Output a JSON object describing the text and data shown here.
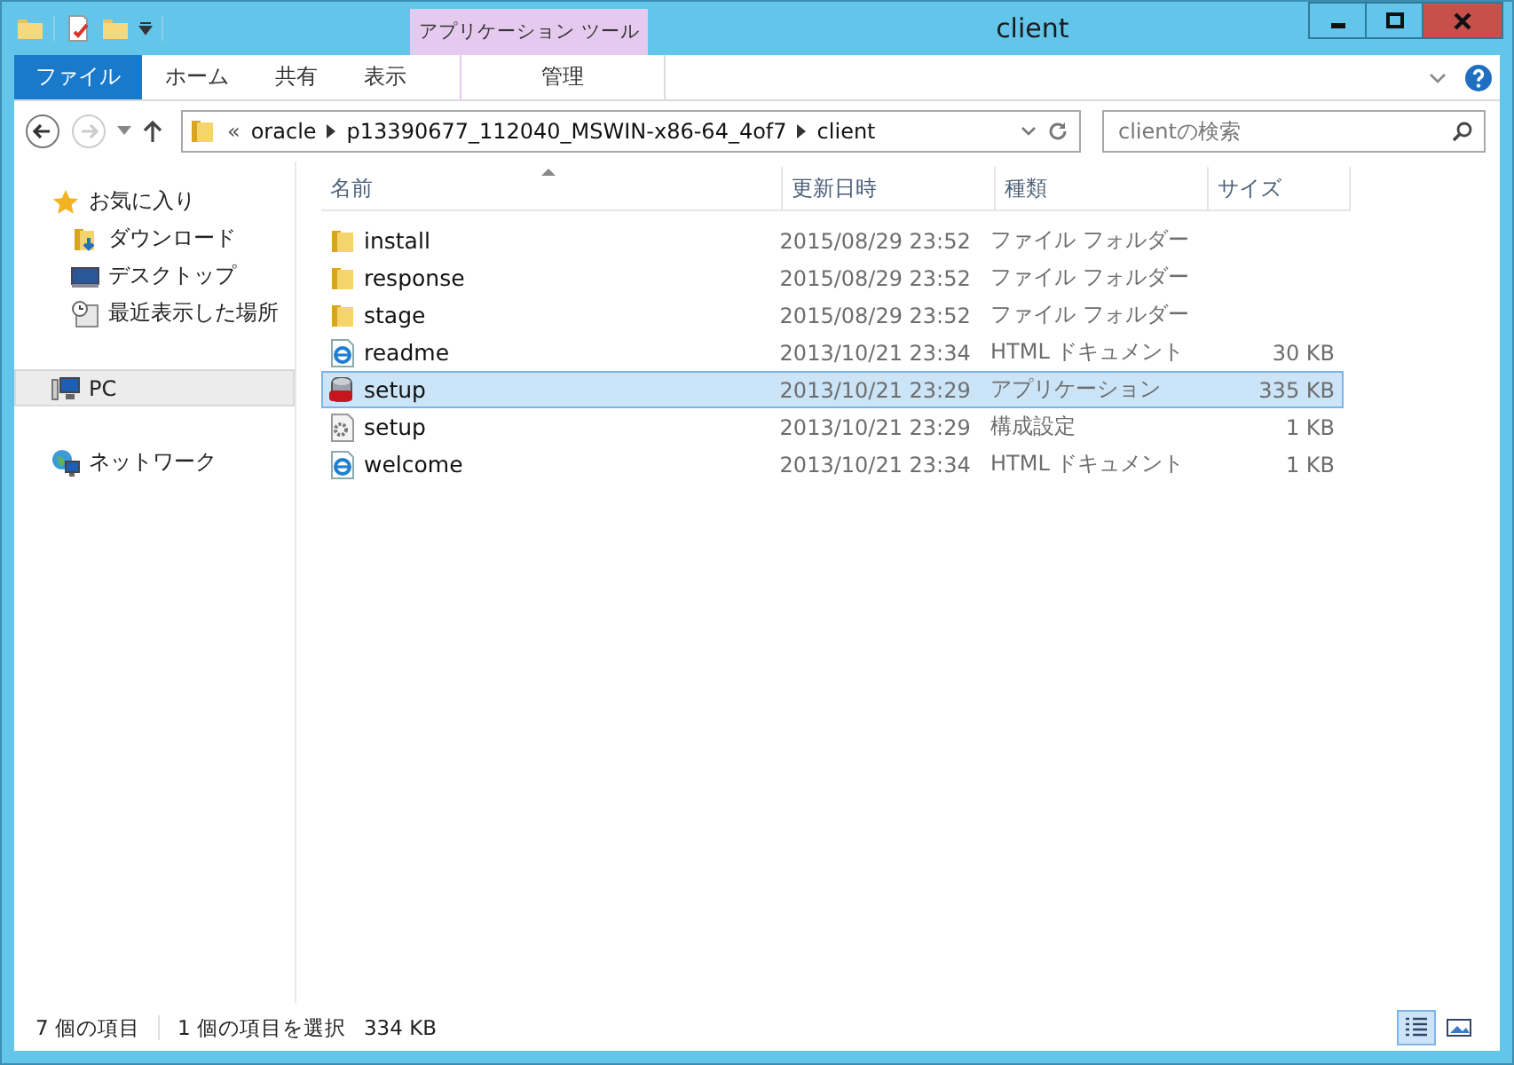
{
  "window": {
    "title": "client",
    "context_tab": "アプリケーション ツール"
  },
  "ribbon_tabs": [
    {
      "label": "ファイル",
      "kind": "file"
    },
    {
      "label": "ホーム",
      "kind": "normal"
    },
    {
      "label": "共有",
      "kind": "normal"
    },
    {
      "label": "表示",
      "kind": "normal"
    },
    {
      "label": "管理",
      "kind": "context"
    }
  ],
  "address": {
    "overflow": "«",
    "segments": [
      "oracle",
      "p13390677_112040_MSWIN-x86-64_4of7",
      "client"
    ]
  },
  "search": {
    "placeholder": "clientの検索"
  },
  "sidebar": {
    "items": [
      {
        "label": "お気に入り",
        "kind": "star",
        "selected": false,
        "children": [
          {
            "label": "ダウンロード",
            "kind": "download",
            "selected": false
          },
          {
            "label": "デスクトップ",
            "kind": "desktop",
            "selected": false
          },
          {
            "label": "最近表示した場所",
            "kind": "recent",
            "selected": false
          }
        ]
      },
      {
        "label": "PC",
        "kind": "pc",
        "selected": true
      },
      {
        "label": "ネットワーク",
        "kind": "network",
        "selected": false
      }
    ]
  },
  "table": {
    "columns": [
      {
        "label": "名前",
        "sorted": true
      },
      {
        "label": "更新日時",
        "sorted": false
      },
      {
        "label": "種類",
        "sorted": false
      },
      {
        "label": "サイズ",
        "sorted": false
      }
    ],
    "rows": [
      {
        "name": "install",
        "date": "2015/08/29 23:52",
        "type": "ファイル フォルダー",
        "kind": "folder",
        "selected": false
      },
      {
        "name": "response",
        "date": "2015/08/29 23:52",
        "type": "ファイル フォルダー",
        "kind": "folder",
        "selected": false
      },
      {
        "name": "stage",
        "date": "2015/08/29 23:52",
        "type": "ファイル フォルダー",
        "kind": "folder",
        "selected": false
      },
      {
        "name": "readme",
        "date": "2013/10/21 23:34",
        "type": "HTML ドキュメント",
        "size": "30 KB",
        "kind": "html",
        "selected": false
      },
      {
        "name": "setup",
        "date": "2013/10/21 23:29",
        "type": "アプリケーション",
        "size": "335 KB",
        "kind": "app",
        "selected": true
      },
      {
        "name": "setup",
        "date": "2013/10/21 23:29",
        "type": "構成設定",
        "size": "1 KB",
        "kind": "config",
        "selected": false
      },
      {
        "name": "welcome",
        "date": "2013/10/21 23:34",
        "type": "HTML ドキュメント",
        "size": "1 KB",
        "kind": "html",
        "selected": false
      }
    ]
  },
  "status_bar": {
    "count": "7 個の項目",
    "selection": "1 個の項目を選択",
    "selection_size": "334 KB",
    "views": [
      {
        "kind": "details",
        "selected": true
      },
      {
        "kind": "thumbnails",
        "selected": false
      }
    ]
  }
}
